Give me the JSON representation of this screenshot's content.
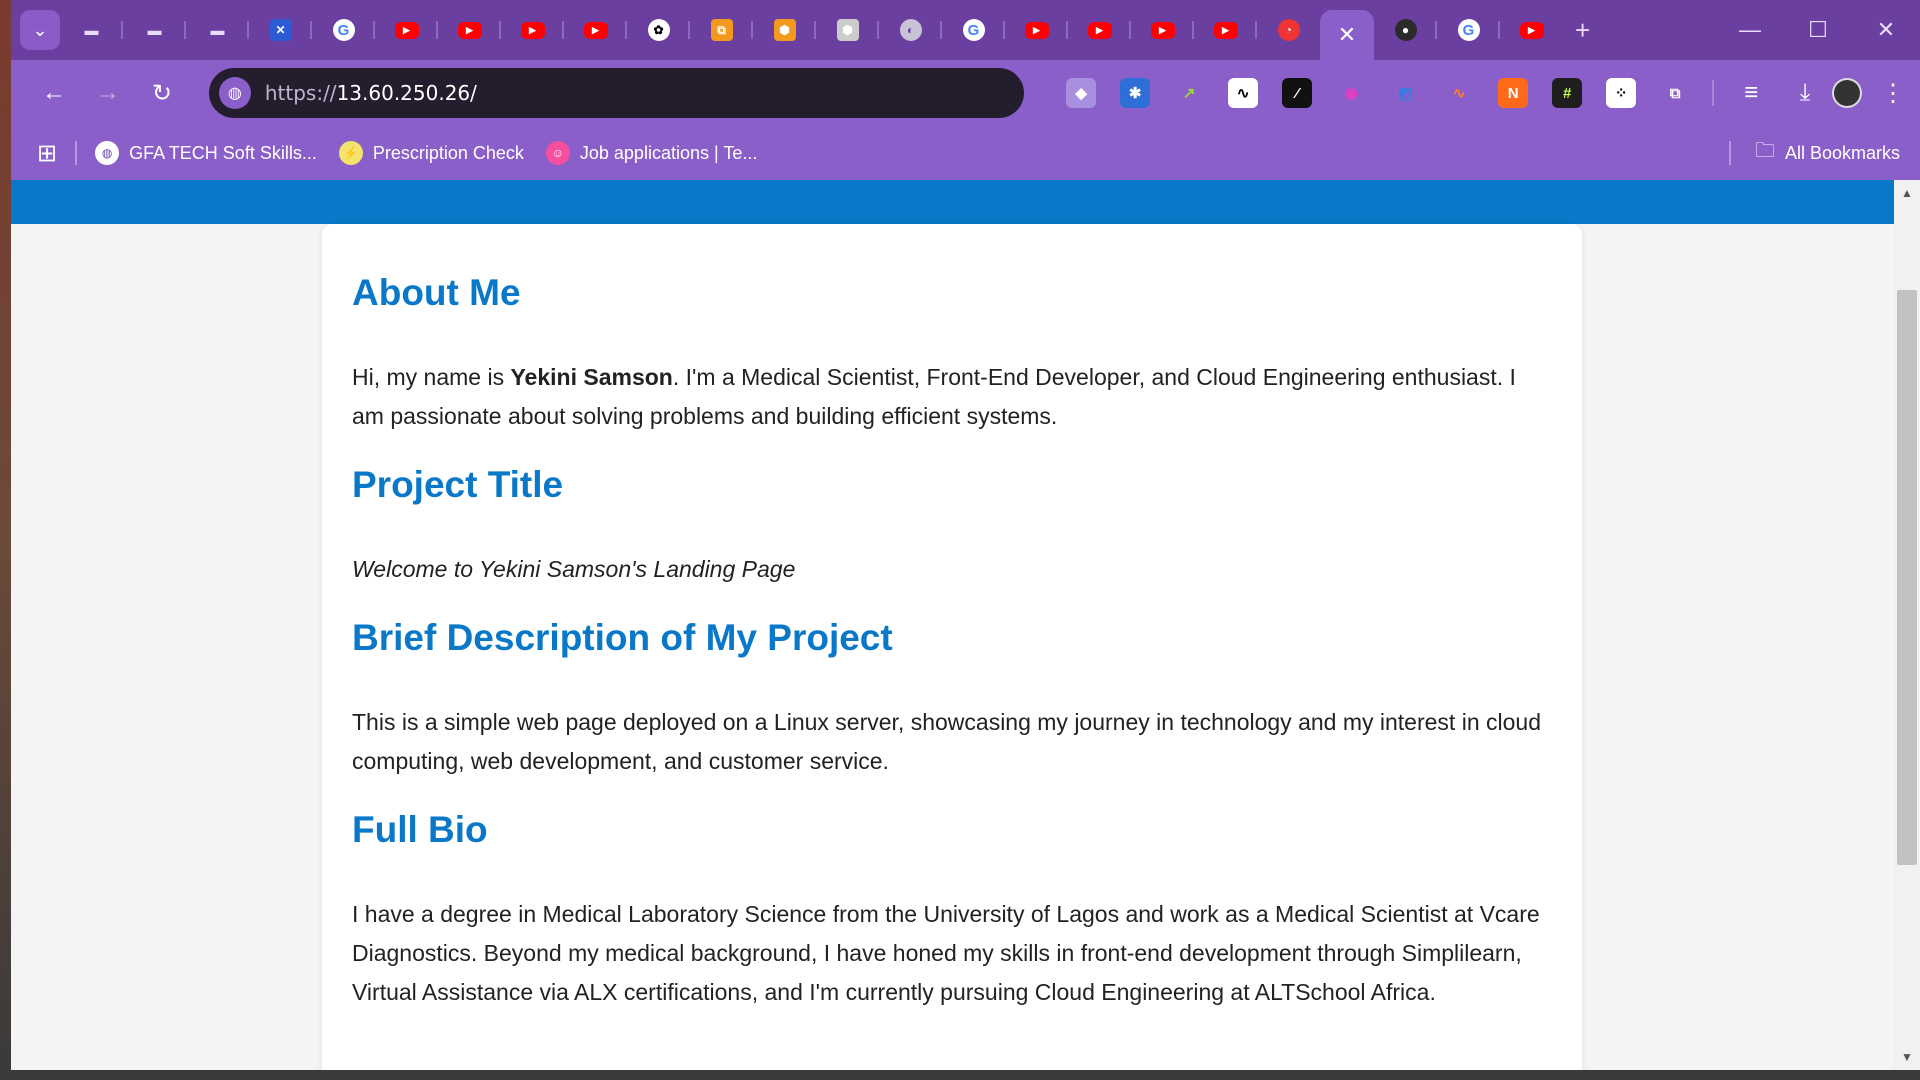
{
  "browser": {
    "tabs": [
      {
        "icon": "tab-search-icon",
        "glyph": "⌄"
      },
      {
        "icon": "folder-icon",
        "glyph": "▬"
      },
      {
        "icon": "folder-icon",
        "glyph": "▬"
      },
      {
        "icon": "folder-icon",
        "glyph": "▬"
      },
      {
        "icon": "blue-app-icon",
        "glyph": "✕"
      },
      {
        "icon": "google-icon",
        "glyph": "G"
      },
      {
        "icon": "youtube-icon",
        "glyph": "▶"
      },
      {
        "icon": "youtube-icon",
        "glyph": "▶"
      },
      {
        "icon": "youtube-icon",
        "glyph": "▶"
      },
      {
        "icon": "youtube-icon",
        "glyph": "▶"
      },
      {
        "icon": "chatgpt-icon",
        "glyph": "✿"
      },
      {
        "icon": "orange-app-icon",
        "glyph": "⧉"
      },
      {
        "icon": "orange-cube-icon",
        "glyph": "⬢"
      },
      {
        "icon": "gray-hexagon-icon",
        "glyph": "⬢"
      },
      {
        "icon": "globe-icon",
        "glyph": "◐"
      },
      {
        "icon": "google-icon",
        "glyph": "G"
      },
      {
        "icon": "youtube-icon",
        "glyph": "▶"
      },
      {
        "icon": "youtube-icon",
        "glyph": "▶"
      },
      {
        "icon": "youtube-icon",
        "glyph": "▶"
      },
      {
        "icon": "youtube-icon",
        "glyph": "▶"
      },
      {
        "icon": "speedometer-icon",
        "glyph": "◔"
      }
    ],
    "active_tab_close": "✕",
    "tabs_after": [
      {
        "icon": "github-icon",
        "glyph": "●"
      },
      {
        "icon": "google-icon",
        "glyph": "G"
      },
      {
        "icon": "youtube-icon",
        "glyph": "▶"
      }
    ],
    "new_tab": "+",
    "window_controls": {
      "minimize": "—",
      "maximize": "☐",
      "close": "✕"
    },
    "toolbar": {
      "back": "←",
      "forward": "→",
      "reload": "↻",
      "url_scheme": "https://",
      "url_host": "13.60.250.26/"
    },
    "extensions": [
      {
        "name": "purple-ext-icon",
        "glyph": "◆",
        "bg": "#a98fe0",
        "color": "#fff"
      },
      {
        "name": "blue-star-ext-icon",
        "glyph": "✱",
        "bg": "#2d6fd6",
        "color": "#fff"
      },
      {
        "name": "green-chart-ext-icon",
        "glyph": "↗",
        "bg": "#8b5fc9",
        "color": "#9bdc2a"
      },
      {
        "name": "wave-ext-icon",
        "glyph": "∿",
        "bg": "#ffffff",
        "color": "#000"
      },
      {
        "name": "black-slash-ext-icon",
        "glyph": "⁄",
        "bg": "#111111",
        "color": "#fff"
      },
      {
        "name": "pink-ext-icon",
        "glyph": "◉",
        "bg": "#8b5fc9",
        "color": "#e33ec2"
      },
      {
        "name": "blue-shape-ext-icon",
        "glyph": "◩",
        "bg": "#8b5fc9",
        "color": "#3b7be0"
      },
      {
        "name": "orange-wave-ext-icon",
        "glyph": "∿",
        "bg": "#8b5fc9",
        "color": "#ff7a2a"
      },
      {
        "name": "orange-n-ext-icon",
        "glyph": "N",
        "bg": "#ff6a1a",
        "color": "#fff"
      },
      {
        "name": "hash-ext-icon",
        "glyph": "#",
        "bg": "#1e1e1e",
        "color": "#c6ff3a"
      },
      {
        "name": "dots-ext-icon",
        "glyph": "⁘",
        "bg": "#ffffff",
        "color": "#000"
      },
      {
        "name": "puzzle-icon",
        "glyph": "⧉",
        "bg": "#8b5fc9",
        "color": "#fff"
      }
    ],
    "toolbar_right": {
      "media": "≡",
      "download": "⤓",
      "menu": "⋮"
    },
    "bookmarks": [
      {
        "label": "GFA TECH Soft Skills...",
        "icon": "globe-icon",
        "glyph": "◍",
        "bg": "#ffffff",
        "color": "#6a3fa0"
      },
      {
        "label": "Prescription Check",
        "icon": "lightning-icon",
        "glyph": "⚡",
        "bg": "#f3e36b",
        "color": "#d64e00"
      },
      {
        "label": "Job applications | Te...",
        "icon": "pink-robot-icon",
        "glyph": "☺",
        "bg": "#f54fa0",
        "color": "#fff"
      }
    ],
    "apps_glyph": "⊞",
    "all_bookmarks": "All Bookmarks"
  },
  "page": {
    "sections": [
      {
        "heading": "About Me",
        "text_before": "Hi, my name is ",
        "text_bold": "Yekini Samson",
        "text_after": ". I'm a Medical Scientist, Front-End Developer, and Cloud Engineering enthusiast. I am passionate about solving problems and building efficient systems."
      },
      {
        "heading": "Project Title",
        "text": "Welcome to Yekini Samson's Landing Page"
      },
      {
        "heading": "Brief Description of My Project",
        "text": "This is a simple web page deployed on a Linux server, showcasing my journey in technology and my interest in cloud computing, web development, and customer service."
      },
      {
        "heading": "Full Bio",
        "text": "I have a degree in Medical Laboratory Science from the University of Lagos and work as a Medical Scientist at Vcare Diagnostics. Beyond my medical background, I have honed my skills in front-end development through Simplilearn, Virtual Assistance via ALX certifications, and I'm currently pursuing Cloud Engineering at ALTSchool Africa."
      }
    ]
  },
  "colors": {
    "browser_frame": "#6a3fa0",
    "toolbar": "#8b5fc9",
    "header_band": "#0a78c8",
    "heading": "#0a78c8"
  }
}
